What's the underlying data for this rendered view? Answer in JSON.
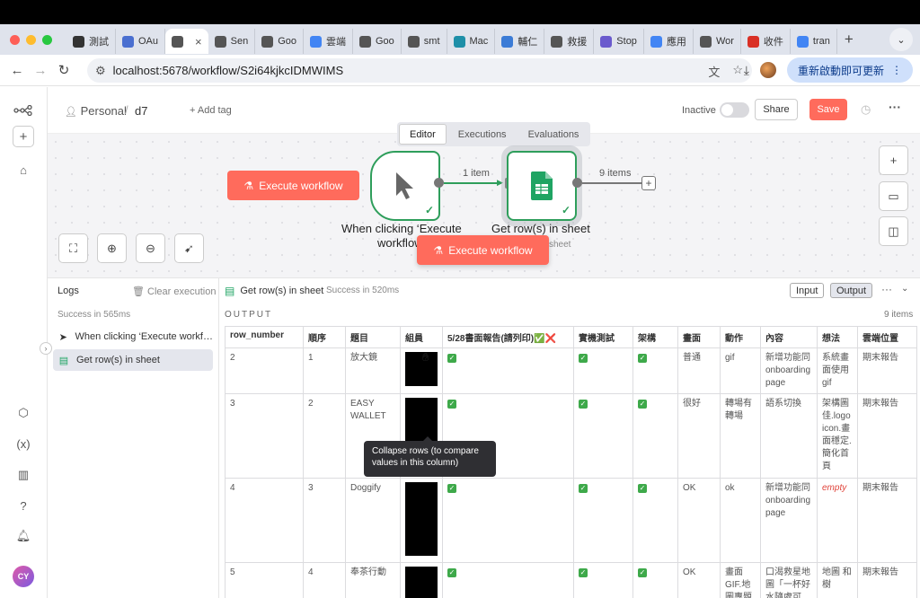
{
  "browser": {
    "tabs": [
      {
        "label": "測試",
        "icon": "chatgpt-icon",
        "color": "#333"
      },
      {
        "label": "OAu",
        "icon": "shield-icon",
        "color": "#4a6fd0"
      },
      {
        "label": "",
        "icon": "n8n-icon",
        "color": "#555",
        "active": true
      },
      {
        "label": "Sen",
        "icon": "n8n-icon",
        "color": "#555"
      },
      {
        "label": "Goo",
        "icon": "n8n-icon",
        "color": "#555"
      },
      {
        "label": "雲端",
        "icon": "cloud-icon",
        "color": "#4285f4"
      },
      {
        "label": "Goo",
        "icon": "n8n-icon",
        "color": "#555"
      },
      {
        "label": "smt",
        "icon": "globe-icon",
        "color": "#555"
      },
      {
        "label": "Mac",
        "icon": "make-icon",
        "color": "#1e8fa8"
      },
      {
        "label": "輔仁",
        "icon": "tool-icon",
        "color": "#3b7bd6"
      },
      {
        "label": "救援",
        "icon": "globe-icon",
        "color": "#555"
      },
      {
        "label": "Stop",
        "icon": "stop-icon",
        "color": "#6a5acd"
      },
      {
        "label": "應用",
        "icon": "google-icon",
        "color": "#4285f4"
      },
      {
        "label": "Wor",
        "icon": "n8n-icon",
        "color": "#555"
      },
      {
        "label": "收件",
        "icon": "gmail-icon",
        "color": "#d93025"
      },
      {
        "label": "tran",
        "icon": "google-icon",
        "color": "#4285f4"
      }
    ],
    "url": "localhost:5678/workflow/S2i64kjkcIDMWIMS",
    "update_label": "重新啟動即可更新"
  },
  "header": {
    "project": "Personal",
    "workflow_name": "d7",
    "add_tag": "+ Add tag",
    "status_label": "Inactive",
    "share": "Share",
    "save": "Save"
  },
  "canvas": {
    "mode_tabs": [
      "Editor",
      "Executions",
      "Evaluations"
    ],
    "active_mode": "Editor",
    "execute_label": "Execute workflow",
    "trigger_node": {
      "label": "When clicking ‘Execute",
      "label_line2": "workflow’"
    },
    "sheet_node": {
      "label": "Get row(s) in sheet",
      "sub": "sheet"
    },
    "conn1_label": "1 item",
    "conn2_label": "9 items"
  },
  "logs": {
    "title": "Logs",
    "clear": "Clear execution",
    "status": "Success in 565ms",
    "items": [
      {
        "label": "When clicking ‘Execute workf…",
        "icon": "cursor-icon"
      },
      {
        "label": "Get row(s) in sheet",
        "icon": "sheets-icon",
        "selected": true
      }
    ]
  },
  "output": {
    "node_name": "Get row(s) in sheet",
    "status": "Success in 520ms",
    "input_btn": "Input",
    "output_btn": "Output",
    "section_label": "OUTPUT",
    "items_count": "9 items",
    "columns": [
      "row_number",
      "順序",
      "題目",
      "組員",
      "5/28書面報告(請列印)✅❌",
      "實機測試",
      "架構",
      "畫面",
      "動作",
      "內容",
      "想法",
      "雲端位置"
    ],
    "rows": [
      [
        "2",
        "1",
        "放大鏡",
        "",
        "✅",
        "✅",
        "✅",
        "普通",
        "gif",
        "新增功能同onboarding page",
        "系統畫面使用gif",
        "期末報告"
      ],
      [
        "3",
        "2",
        "EASY WALLET",
        "",
        "✅",
        "✅",
        "✅",
        "很好",
        "轉場有轉場",
        "語系切換",
        "架構圖佳.logo icon.畫面穩定.簡化首頁",
        "期末報告"
      ],
      [
        "4",
        "3",
        "Doggify",
        "",
        "✅",
        "✅",
        "✅",
        "OK",
        "ok",
        "新增功能同onboarding page",
        "empty",
        "期末報告"
      ],
      [
        "5",
        "4",
        "奉茶行動",
        "",
        "✅",
        "✅",
        "✅",
        "OK",
        "畫面GIF.地圖專題",
        "口渴救星地圖「一杯好水隨處可",
        "地圖 和樹",
        "期末報告"
      ]
    ],
    "tooltip": "Collapse rows (to compare values in this column)"
  },
  "colors": {
    "accent": "#ff6b5c",
    "success": "#2e9e5b"
  }
}
